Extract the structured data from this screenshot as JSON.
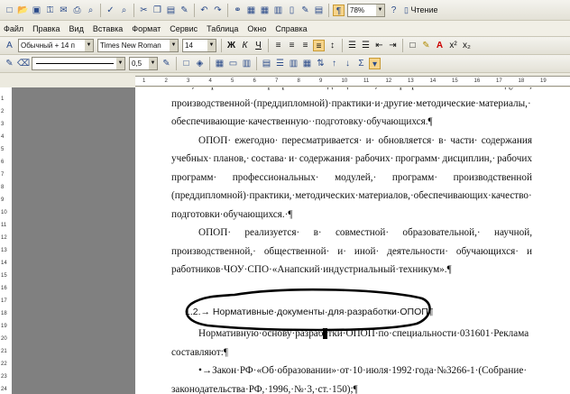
{
  "toolbar": {
    "zoom": "78%",
    "read_button": "Чтение",
    "icons": [
      "new-icon",
      "open-icon",
      "save-icon",
      "permission-icon",
      "email-icon",
      "print-icon",
      "print-preview-icon",
      "spelling-icon",
      "research-icon",
      "cut-icon",
      "copy-icon",
      "paste-icon",
      "format-painter-icon",
      "undo-icon",
      "redo-icon",
      "hyperlink-icon",
      "tables-borders-icon",
      "insert-table-icon",
      "insert-excel-icon",
      "columns-icon",
      "drawing-icon",
      "document-map-icon",
      "show-hide-icon",
      "help-icon"
    ]
  },
  "menu": [
    "Файл",
    "Правка",
    "Вид",
    "Вставка",
    "Формат",
    "Сервис",
    "Таблица",
    "Окно",
    "Справка"
  ],
  "formatting": {
    "style": "Обычный + 14 п",
    "font": "Times New Roman",
    "size": "14",
    "bold": "Ж",
    "italic": "К",
    "underline": "Ч",
    "line_width": "0,5"
  },
  "ruler": {
    "h_labels": [
      "1",
      "2",
      "3",
      "4",
      "5",
      "6",
      "7",
      "8",
      "9",
      "10",
      "11",
      "12",
      "13",
      "14",
      "15",
      "16",
      "17",
      "18",
      "19"
    ],
    "v_labels": [
      "1",
      "2",
      "3",
      "4",
      "5",
      "6",
      "7",
      "8",
      "9",
      "10",
      "11",
      "12",
      "13",
      "14",
      "15",
      "16",
      "17",
      "18",
      "19",
      "20",
      "21",
      "22",
      "23",
      "24"
    ]
  },
  "document": {
    "lines": [
      {
        "words": [
          "план,",
          "рабочие",
          "программы",
          "дисциплин,",
          "профессиональных",
          "модулей,"
        ],
        "indent": false,
        "justify": true
      },
      {
        "text": "производственной·(преддипломной)·практики·и·другие·методические·материалы,·",
        "indent": false,
        "justify": false
      },
      {
        "text": "обеспечивающие·качественную··подготовку·обучающихся.¶",
        "indent": false,
        "justify": false
      },
      {
        "words": [
          "ОПОП·",
          "ежегодно·",
          "пересматривается·",
          "и·",
          "обновляется·",
          "в·",
          "части·",
          "содержания"
        ],
        "indent": true,
        "justify": true
      },
      {
        "words": [
          "учебных·",
          "планов,·",
          "состава·",
          "и·",
          "содержания·",
          "рабочих·",
          "программ·",
          "дисциплин,·",
          "рабочих"
        ],
        "indent": false,
        "justify": true
      },
      {
        "words": [
          "программ·",
          "профессиональных·",
          "модулей,·",
          "программ·",
          "производственной"
        ],
        "indent": false,
        "justify": true
      },
      {
        "text": "(преддипломной)·практики,·методических·материалов,·обеспечивающих·качество·",
        "indent": false,
        "justify": false
      },
      {
        "text": "подготовки·обучающихся.·¶",
        "indent": false,
        "justify": false
      },
      {
        "words": [
          "ОПОП·",
          "реализуется·",
          "в·",
          "совместной·",
          "образовательной,·",
          "научной,"
        ],
        "indent": true,
        "justify": true
      },
      {
        "words": [
          "производственной,·",
          "общественной·",
          "и·",
          "иной·",
          "деятельности·",
          "обучающихся·",
          "и"
        ],
        "indent": false,
        "justify": true
      },
      {
        "text": "работников·ЧОУ·СПО·«Анапский·индустриальный·техникум».¶",
        "indent": false,
        "justify": false
      }
    ],
    "heading": "1.2.→ Нормативные·документы·для·разработки·ОПОП¶",
    "after_lines": [
      {
        "text_before": "Нормативную·основу·разраб",
        "text_after": "тки·ОПОП·по·специальности·031601·Реклама",
        "indent": true
      },
      {
        "text": "составляют:¶",
        "indent": false
      },
      {
        "text": "•→Закон·РФ·«Об·образовании»·от·10·июля·1992·года·№3266-1·(Собрание·",
        "indent": true
      },
      {
        "text": "законодательства·РФ,·1996,·№·3,·ст.·150);¶",
        "indent": false
      }
    ]
  }
}
